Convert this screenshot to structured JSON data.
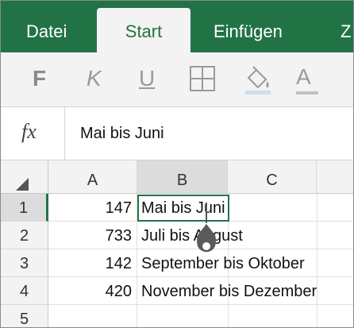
{
  "ribbon": {
    "tabs": [
      {
        "label": "Datei"
      },
      {
        "label": "Start"
      },
      {
        "label": "Einfügen"
      },
      {
        "label": "Z"
      }
    ],
    "active_tab": "Start",
    "colors": {
      "ribbon_bg": "#217346",
      "active_text": "#217346",
      "toolbar_bg": "#f3f3f3"
    }
  },
  "toolbar": {
    "bold_label": "F",
    "italic_label": "K",
    "underline_label": "U",
    "borders_icon": "borders-grid-icon",
    "fill_icon": "fill-color-bucket-icon",
    "font_color_label": "A"
  },
  "formula_bar": {
    "fx_label": "fx",
    "content": "Mai bis Juni"
  },
  "grid": {
    "columns": [
      "A",
      "B",
      "C"
    ],
    "selected_column": "B",
    "rows": [
      {
        "row": "1",
        "a": "147",
        "b": "Mai bis Juni"
      },
      {
        "row": "2",
        "a": "733",
        "b": "Juli bis August"
      },
      {
        "row": "3",
        "a": "142",
        "b": "September bis Oktober"
      },
      {
        "row": "4",
        "a": "420",
        "b": "November bis Dezember"
      },
      {
        "row": "5",
        "a": "",
        "b": ""
      }
    ],
    "selected_cell": "B1",
    "selection_color": "#217346"
  }
}
